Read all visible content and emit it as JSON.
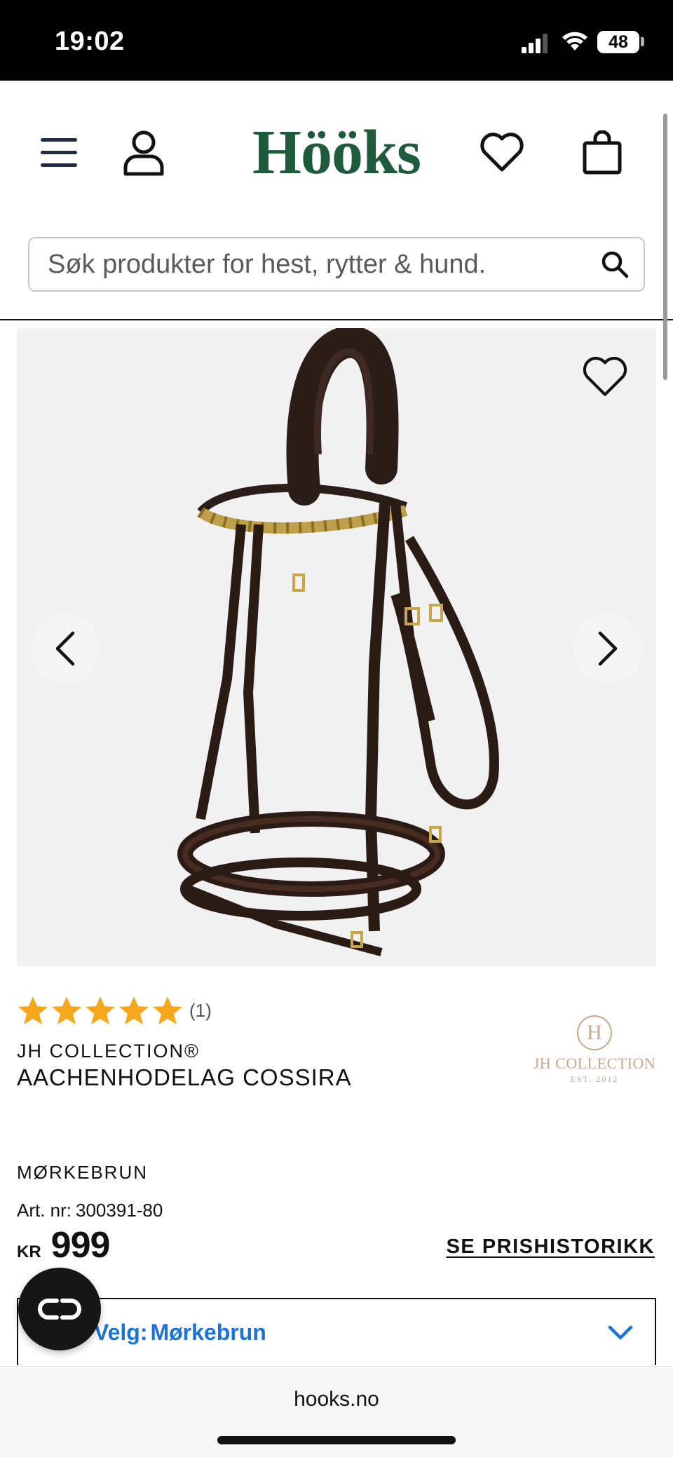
{
  "status_bar": {
    "time": "19:02",
    "battery": "48"
  },
  "header": {
    "logo": "Hööks",
    "search": {
      "placeholder": "Søk produkter for hest, rytter & hund."
    }
  },
  "product": {
    "rating": {
      "stars": 5,
      "max": 5,
      "count": "(1)"
    },
    "brand": "JH COLLECTION®",
    "title": "AACHENHODELAG COSSIRA",
    "brand_logo": {
      "monogram": "H",
      "name": "JH COLLECTION",
      "est": "EST. 2012"
    },
    "color": "MØRKEBRUN",
    "art_nr_label": "Art. nr:",
    "art_nr": "300391-80",
    "price": {
      "currency": "KR",
      "amount": "999"
    },
    "price_history_link": "SE PRISHISTORIKK",
    "variant": {
      "label": "Velg:",
      "value": "Mørkebrun"
    }
  },
  "browser": {
    "url": "hooks.no"
  },
  "colors": {
    "brand_green": "#1e5b3c",
    "link_blue": "#1a73d9",
    "star": "#f7a71b",
    "brand_logo_tan": "#c9a78a"
  },
  "icons": [
    "menu-icon",
    "user-icon",
    "heart-icon",
    "bag-icon",
    "search-icon",
    "chevron-left-icon",
    "chevron-right-icon",
    "star-icon",
    "chevron-down-icon",
    "chat-icon"
  ]
}
